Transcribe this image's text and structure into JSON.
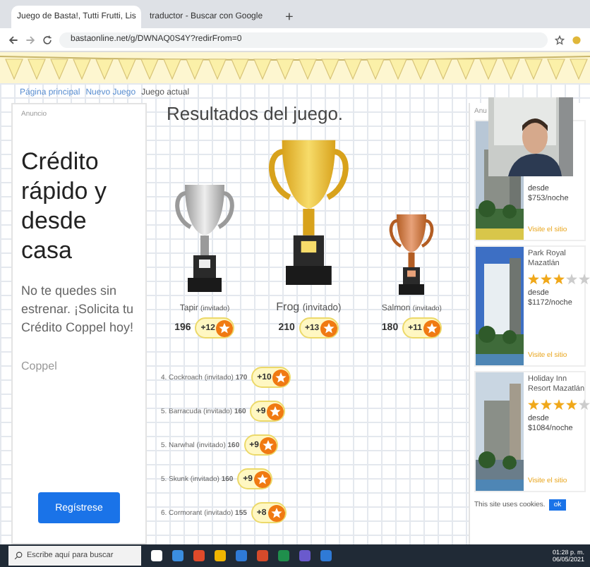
{
  "browser": {
    "tabs": [
      {
        "title": "Juego de Basta!, Tutti Frutti, Lis",
        "selected": true
      },
      {
        "title": "traductor - Buscar con Google",
        "selected": false
      }
    ],
    "new_tab": "+",
    "url": "bastaonline.net/g/DWNAQ0S4Y?redirFrom=0"
  },
  "breadcrumb": [
    "Página principal",
    "Nuevo Juego",
    "Juego actual"
  ],
  "ad": {
    "label": "Anuncio",
    "headline": "Crédito rápido y desde casa",
    "body": "No te quedes sin estrenar. ¡Solicita tu Crédito Coppel hoy!",
    "advertiser": "Coppel",
    "button": "Regístrese"
  },
  "results": {
    "title": "Resultados del juego.",
    "podium": [
      {
        "kind": "silver",
        "name": "Tapir",
        "tag": "(invitado)",
        "score": "196",
        "bonus": "+12"
      },
      {
        "kind": "gold",
        "name": "Frog",
        "tag": "(invitado)",
        "score": "210",
        "bonus": "+13"
      },
      {
        "kind": "bronze",
        "name": "Salmon",
        "tag": "(invitado)",
        "score": "180",
        "bonus": "+11"
      }
    ],
    "others": [
      {
        "name": "4. Cockroach",
        "tag": "(invitado)",
        "score": "170",
        "bonus": "+10"
      },
      {
        "name": "5. Barracuda",
        "tag": "(invitado)",
        "score": "160",
        "bonus": "+9"
      },
      {
        "name": "5. Narwhal",
        "tag": "(invitado)",
        "score": "160",
        "bonus": "+9"
      },
      {
        "name": "5. Skunk",
        "tag": "(invitado)",
        "score": "160",
        "bonus": "+9"
      },
      {
        "name": "6. Cormorant",
        "tag": "(invitado)",
        "score": "155",
        "bonus": "+8"
      }
    ]
  },
  "hotels": {
    "label": "Anu",
    "items": [
      {
        "price": "desde $753/noche",
        "link": "Visite el sitio"
      },
      {
        "name": "Park Royal Mazatlán",
        "stars": 3,
        "price": "desde $1172/noche",
        "link": "Visite el sitio"
      },
      {
        "name": "Holiday Inn Resort Mazatlán",
        "stars": 4,
        "price": "desde $1084/noche",
        "link": "Visite el sitio"
      }
    ],
    "cookie_text": "This site uses cookies.",
    "cookie_button": "ok"
  },
  "taskbar": {
    "search_placeholder": "Escribe aquí para buscar",
    "time": "01:28 p. m.",
    "date": "06/05/2021"
  }
}
